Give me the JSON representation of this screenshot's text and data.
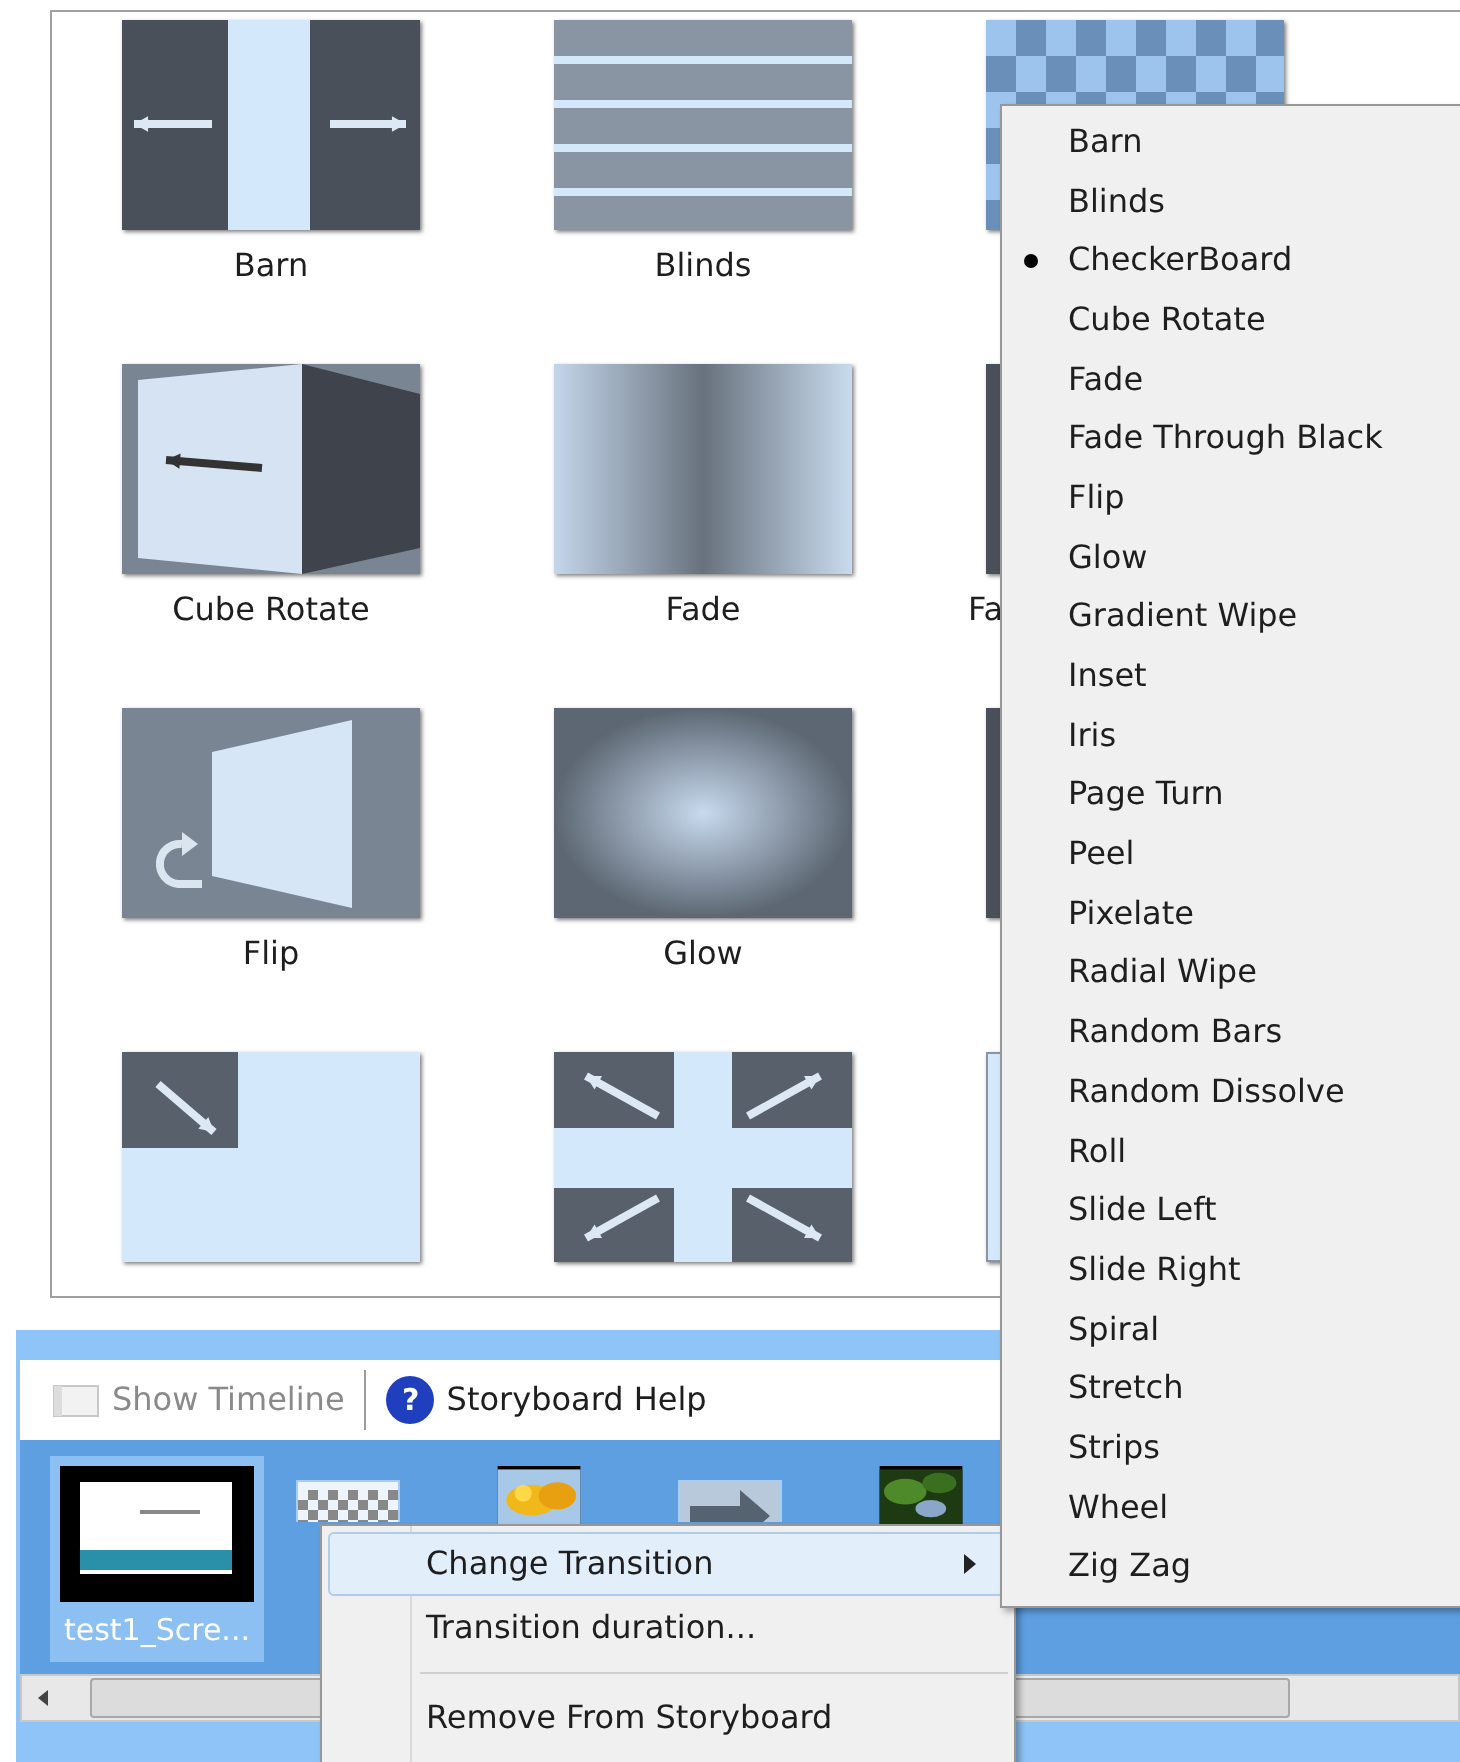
{
  "gallery": [
    {
      "kind": "barn",
      "label": "Barn"
    },
    {
      "kind": "blinds",
      "label": "Blinds"
    },
    {
      "kind": "checkerboard"
    },
    {
      "kind": "cube_rotate",
      "label": "Cube Rotate"
    },
    {
      "kind": "fade",
      "label": "Fade"
    },
    {
      "kind": "dark",
      "label": "Fa"
    },
    {
      "kind": "flip",
      "label": "Flip"
    },
    {
      "kind": "glow",
      "label": "Glow"
    },
    {
      "kind": "dark"
    },
    {
      "kind": "inset"
    },
    {
      "kind": "iris"
    },
    {
      "kind": "light"
    }
  ],
  "storyboard": {
    "toolbar": [
      {
        "kind": "timeline",
        "label": "Show Timeline",
        "disabled": true
      },
      {
        "kind": "help",
        "icon": "?",
        "label": "Storyboard Help",
        "disabled": false
      }
    ],
    "items": [
      {
        "kind": "clip",
        "label": "test1_Scre...",
        "selected": true
      },
      {
        "kind": "transition",
        "selected": false
      },
      {
        "kind": "clip",
        "selected": false
      },
      {
        "kind": "transition",
        "selected": false
      },
      {
        "kind": "clip",
        "selected": false
      }
    ]
  },
  "context_menu": [
    {
      "kind": "item",
      "label": "Change Transition",
      "selected": true,
      "submenu": true
    },
    {
      "kind": "item",
      "label": "Transition duration...",
      "selected": false,
      "submenu": false
    },
    {
      "kind": "separator"
    },
    {
      "kind": "item",
      "label": "Remove From Storyboard",
      "selected": false,
      "submenu": false
    }
  ],
  "submenu": [
    {
      "label": "Barn",
      "selected": false
    },
    {
      "label": "Blinds",
      "selected": false
    },
    {
      "label": "CheckerBoard",
      "selected": true
    },
    {
      "label": "Cube Rotate",
      "selected": false
    },
    {
      "label": "Fade",
      "selected": false
    },
    {
      "label": "Fade Through Black",
      "selected": false
    },
    {
      "label": "Flip",
      "selected": false
    },
    {
      "label": "Glow",
      "selected": false
    },
    {
      "label": "Gradient Wipe",
      "selected": false
    },
    {
      "label": "Inset",
      "selected": false
    },
    {
      "label": "Iris",
      "selected": false
    },
    {
      "label": "Page Turn",
      "selected": false
    },
    {
      "label": "Peel",
      "selected": false
    },
    {
      "label": "Pixelate",
      "selected": false
    },
    {
      "label": "Radial Wipe",
      "selected": false
    },
    {
      "label": "Random Bars",
      "selected": false
    },
    {
      "label": "Random Dissolve",
      "selected": false
    },
    {
      "label": "Roll",
      "selected": false
    },
    {
      "label": "Slide Left",
      "selected": false
    },
    {
      "label": "Slide Right",
      "selected": false
    },
    {
      "label": "Spiral",
      "selected": false
    },
    {
      "label": "Stretch",
      "selected": false
    },
    {
      "label": "Strips",
      "selected": false
    },
    {
      "label": "Wheel",
      "selected": false
    },
    {
      "label": "Zig Zag",
      "selected": false
    }
  ]
}
